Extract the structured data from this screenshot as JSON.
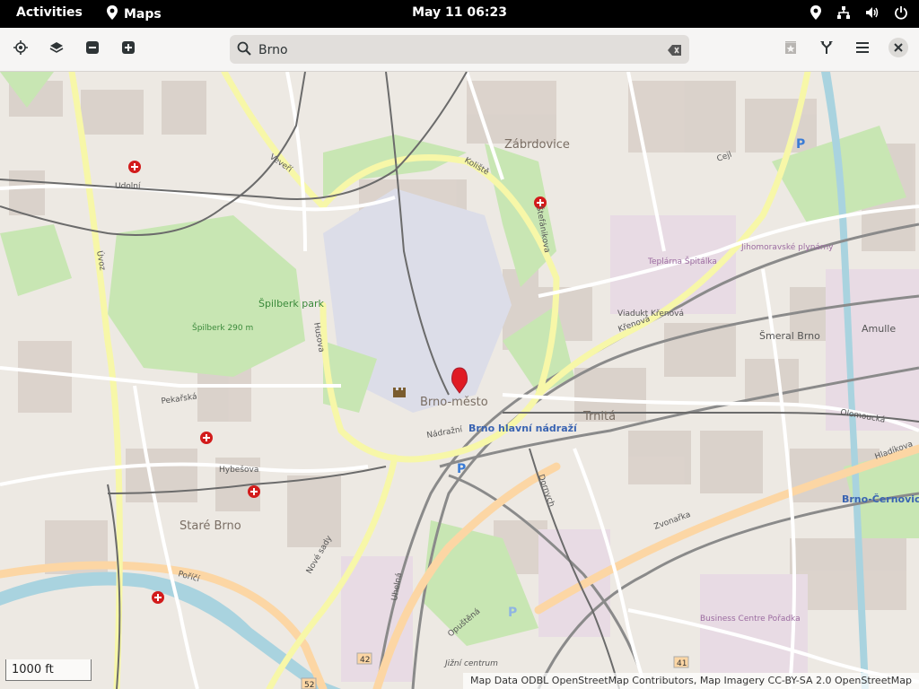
{
  "topbar": {
    "activities": "Activities",
    "app_name": "Maps",
    "clock": "May 11  06:23"
  },
  "header": {
    "search_value": "Brno"
  },
  "map": {
    "district_labels": [
      "Zábrdovice",
      "Trnitá",
      "Brno-město",
      "Staré Brno",
      "Špilberk park",
      "Šmeral Brno",
      "Amulle",
      "Teplárna Špitálka",
      "Jihomoravské plynárny",
      "Business Centre Pořadka",
      "Jižní centrum"
    ],
    "station_labels": [
      "Brno hlavní nádraží",
      "Brno-Černovice"
    ],
    "street_labels": [
      "Veveří",
      "Koliště",
      "Husova",
      "Pekařská",
      "Křenová",
      "Zvonařka",
      "Hybešova",
      "Nové sady",
      "Uhelná",
      "Opuštěná",
      "Dornych",
      "Úvoz",
      "Udolní",
      "Štefánikova",
      "Poříčí",
      "Hladíkova",
      "Olomoucká",
      "Cejl",
      "Viadukt Křenová",
      "Špilberk 290 m",
      "Nádražní"
    ]
  },
  "scale_label": "1000 ft",
  "attribution": "Map Data ODBL OpenStreetMap Contributors, Map Imagery CC-BY-SA 2.0 OpenStreetMap",
  "colors": {
    "topbar": "#000000",
    "header": "#f6f5f4",
    "map_bg": "#f2efe9",
    "park": "#c8e6b3",
    "road_major": "#fcd6a4",
    "road_yellow": "#f7f7a8",
    "water": "#a9d3df",
    "rail": "#888888",
    "pin": "#e01b24"
  },
  "icons": {
    "locate": "locate-icon",
    "layers": "layers-icon",
    "zoom_out": "zoom-out-icon",
    "zoom_in": "zoom-in-icon",
    "favorite": "favorite-icon",
    "route": "route-icon",
    "menu": "menu-icon",
    "close": "close-icon"
  }
}
